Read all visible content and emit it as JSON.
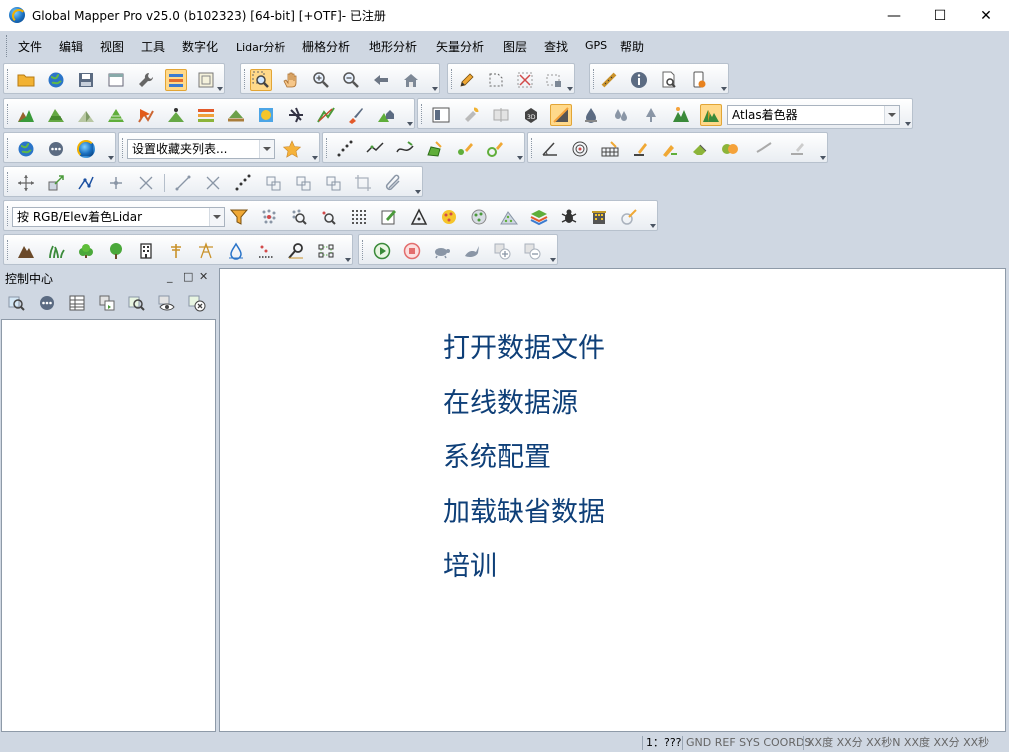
{
  "window": {
    "title": "Global Mapper Pro v25.0 (b102323) [64-bit] [+OTF]- 已注册",
    "minimize": "—",
    "maximize": "☐",
    "close": "✕"
  },
  "menu": {
    "items": [
      "文件",
      "编辑",
      "视图",
      "工具",
      "数字化",
      "Lidar分析",
      "栅格分析",
      "地形分析",
      "矢量分析",
      "图层",
      "查找",
      "GPS",
      "帮助"
    ]
  },
  "toolbars": {
    "shader_select": "Atlas着色器",
    "favorites_select": "设置收藏夹列表...",
    "lidar_color_select": "按 RGB/Elev着色Lidar"
  },
  "control_center": {
    "title": "控制中心",
    "min": "_",
    "restore": "□",
    "close": "✕"
  },
  "start_links": [
    "打开数据文件",
    "在线数据源",
    "系统配置",
    "加载缺省数据",
    "培训"
  ],
  "status": {
    "scale": "1：???",
    "coords_sys": "GND REF SYS COORDS",
    "coords": "XX度 XX分 XX秒N XX度 XX分 XX秒 S"
  },
  "colors": {
    "accent": "#0e3f78",
    "toolbar_bg": "#cfd7e2",
    "active_tool": "#ffd98a"
  }
}
